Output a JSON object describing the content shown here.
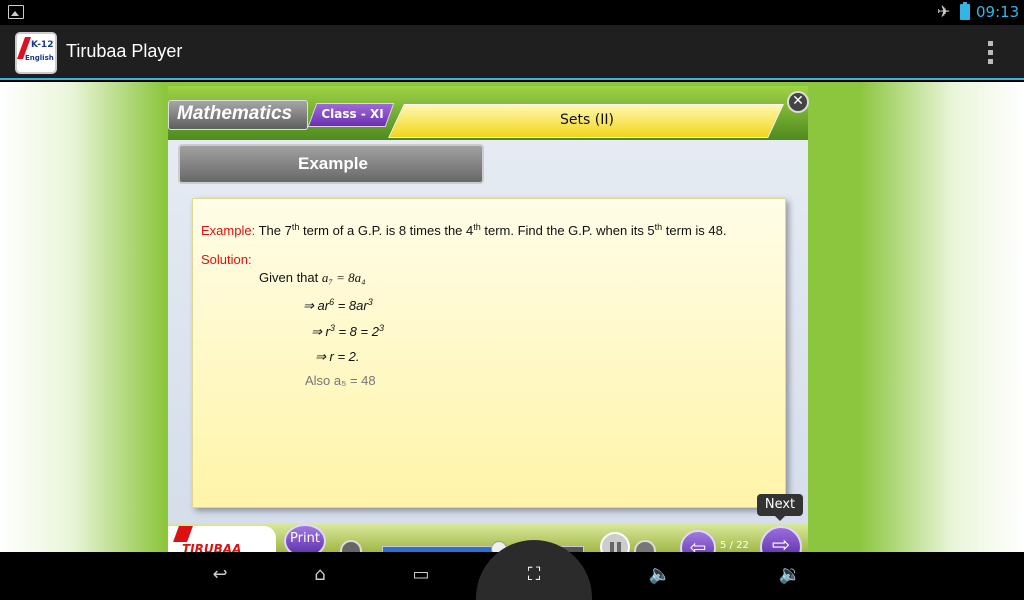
{
  "status": {
    "time": "09:13"
  },
  "app": {
    "title": "Tirubaa Player",
    "icon_k": "K-12",
    "icon_english": "English"
  },
  "player": {
    "subject": "Mathematics",
    "class_tag": "Class - XI",
    "topic": "Sets (II)",
    "section_tab": "Example",
    "close_label": "✕",
    "example_label": "Example:",
    "example_text_1": "The 7",
    "example_sup_1": "th",
    "example_text_2": " term of a G.P. is 8 times the 4",
    "example_sup_2": "th",
    "example_text_3": " term. Find the G.P. when its 5",
    "example_sup_3": "th",
    "example_text_4": " term is 48.",
    "solution_label": "Solution:",
    "step1_prefix": "Given that ",
    "step1_math": "a₇  = 8a₄",
    "step2": "⇒ ar",
    "step2_sup": "6",
    "step2_b": " = 8ar",
    "step2_sup2": "3",
    "step3": "⇒ r",
    "step3_sup": "3",
    "step3_b": " = 8 = 2",
    "step3_sup2": "3",
    "step4": "⇒ r = 2.",
    "step5": "Also a₅  = 48",
    "next_tooltip": "Next",
    "print_label": "Print",
    "brand": "TIRUBAA",
    "page_counter": "5 / 22",
    "progress_fraction": 0.58
  },
  "icons": {
    "plane": "airplane-mode-icon",
    "battery": "battery-icon",
    "gallery": "gallery-notification-icon"
  }
}
